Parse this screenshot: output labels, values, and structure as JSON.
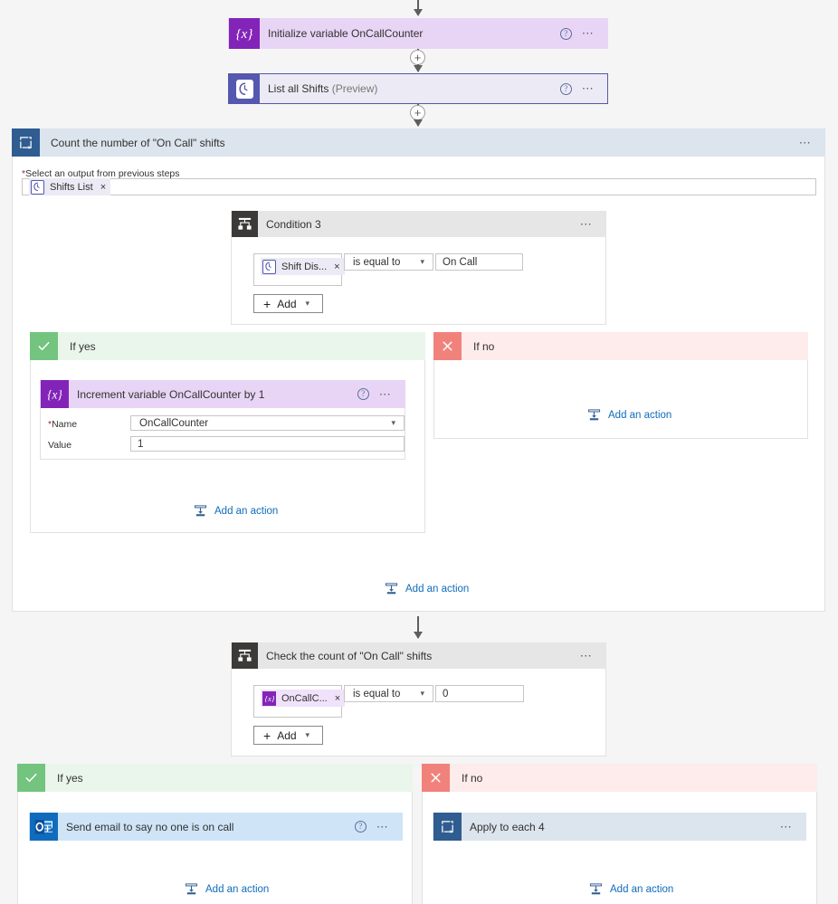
{
  "flow": {
    "steps": [
      {
        "id": "init-variable",
        "title": "Initialize variable OnCallCounter",
        "suffix": "",
        "icon": "variable-braces-icon",
        "kind": "variable"
      },
      {
        "id": "list-all-shifts",
        "title": "List all Shifts",
        "suffix": "(Preview)",
        "icon": "teams-shifts-clock-icon",
        "kind": "teams"
      }
    ]
  },
  "scope": {
    "title": "Count the number of \"On Call\" shifts",
    "icon": "apply-to-each-loop-icon",
    "menu": "...",
    "input_label": "Select an output from previous steps",
    "required_marker": "*",
    "token": {
      "label": "Shifts List",
      "icon": "teams-shifts-clock-icon",
      "remove": "×"
    },
    "add_action": "Add an action"
  },
  "condition1": {
    "title": "Condition 3",
    "icon": "condition-branch-icon",
    "menu": "...",
    "left_token": {
      "label": "Shift Dis...",
      "icon": "teams-shifts-clock-icon",
      "remove": "×"
    },
    "operator": "is equal to",
    "value": "On Call",
    "add_button": "Add",
    "branches": {
      "yes": {
        "label": "If yes",
        "icon": "checkmark-icon"
      },
      "no": {
        "label": "If no",
        "icon": "cross-icon",
        "add_action": "Add an action"
      }
    },
    "yes_action": {
      "title": "Increment variable OnCallCounter by 1",
      "icon": "variable-braces-icon",
      "menu": "...",
      "fields": [
        {
          "label": "Name",
          "required": true,
          "value": "OnCallCounter",
          "type": "select"
        },
        {
          "label": "Value",
          "required": false,
          "value": "1",
          "type": "text"
        }
      ],
      "add_action": "Add an action"
    }
  },
  "condition2": {
    "title": "Check the count of \"On Call\" shifts",
    "icon": "condition-branch-icon",
    "menu": "...",
    "left_token": {
      "label": "OnCallC...",
      "icon": "variable-braces-icon",
      "remove": "×"
    },
    "operator": "is equal to",
    "value": "0",
    "add_button": "Add",
    "branches": {
      "yes": {
        "label": "If yes",
        "icon": "checkmark-icon",
        "action": {
          "title": "Send email to say no one is on call",
          "icon": "outlook-icon",
          "menu": "..."
        },
        "add_action": "Add an action"
      },
      "no": {
        "label": "If no",
        "icon": "cross-icon",
        "action": {
          "title": "Apply to each 4",
          "icon": "apply-to-each-loop-icon",
          "menu": "..."
        },
        "add_action": "Add an action"
      }
    }
  },
  "icons": {
    "help": "?",
    "plus": "+",
    "chevron_down": "∨",
    "add_plus": "+"
  },
  "colors": {
    "variable_purple": "#8324b8",
    "teams_purple": "#5558af",
    "outlook_blue": "#0f6cbd",
    "scope_blue": "#2f5c91",
    "condition_dark": "#3b3a39",
    "yes_green": "#73c47f",
    "no_red": "#f1827b",
    "link_blue": "#0f6cbd"
  }
}
